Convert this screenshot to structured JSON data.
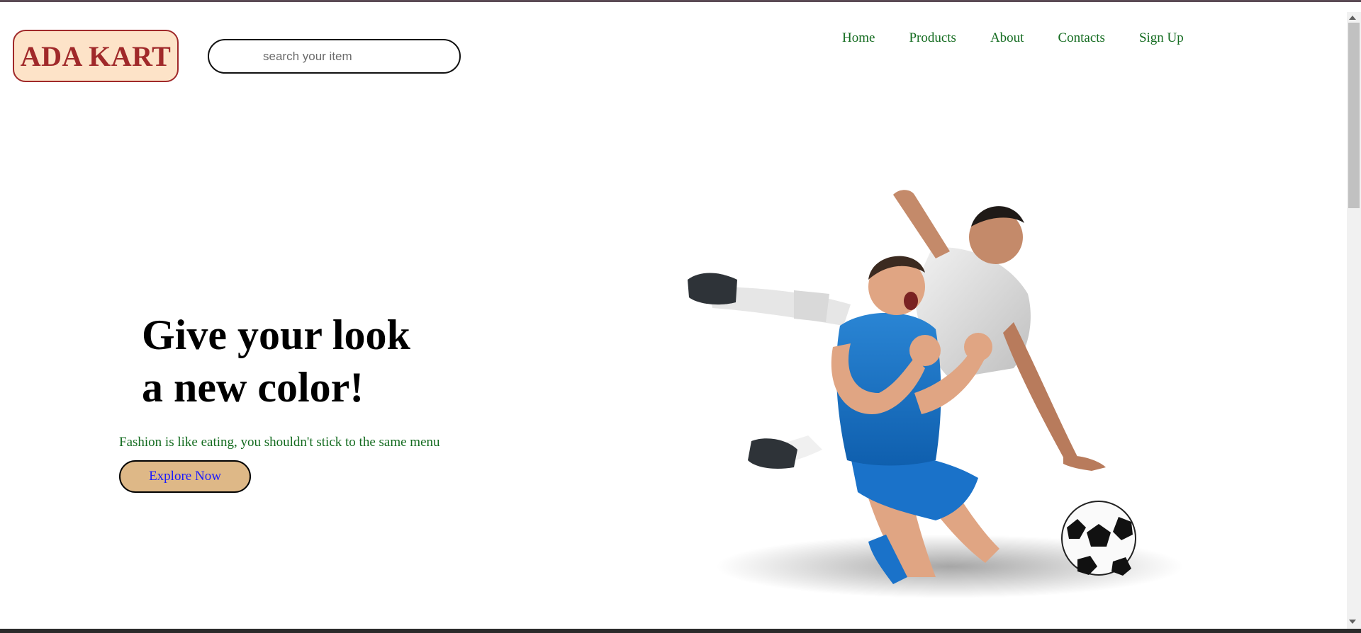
{
  "brand": {
    "logo_text": "ADA KART",
    "colors": {
      "logo_border": "#a0292a",
      "logo_bg": "#fde3c8",
      "nav_link": "#136b1f",
      "button_bg": "#deb887",
      "button_text": "#1a1aff"
    }
  },
  "search": {
    "placeholder": "search your item",
    "value": ""
  },
  "nav": {
    "items": [
      {
        "label": "Home"
      },
      {
        "label": "Products"
      },
      {
        "label": "About"
      },
      {
        "label": "Contacts"
      },
      {
        "label": "Sign Up"
      }
    ]
  },
  "hero": {
    "title_line1": "Give your look",
    "title_line2": "a new color!",
    "subtitle": "Fashion is like eating, you shouldn't stick to the same menu",
    "cta_label": "Explore Now",
    "image": {
      "subject": "soccer-players",
      "icon": "soccer-ball-icon"
    }
  }
}
